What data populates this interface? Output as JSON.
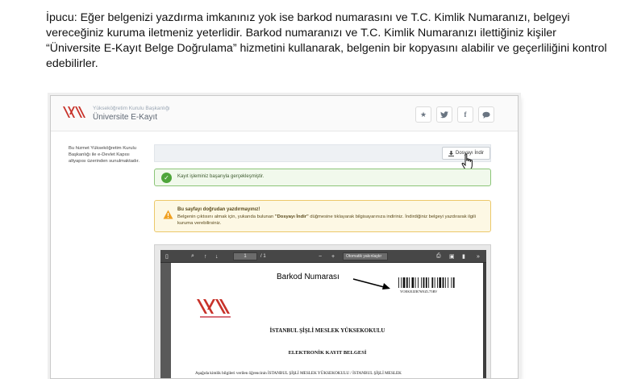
{
  "intro_text": "İpucu: Eğer belgenizi yazdırma imkanınız yok ise barkod numarasını ve T.C. Kimlik Numaranızı, belgeyi vereceğiniz kuruma iletmeniz yeterlidir. Barkod numaranızı ve T.C. Kimlik Numaranızı ilettiğiniz kişiler “Üniversite E-Kayıt Belge Doğrulama” hizmetini kullanarak, belgenin bir kopyasını alabilir ve geçerliliğini kontrol edebilirler.",
  "header": {
    "org_name": "Yükseköğretim Kurulu Başkanlığı",
    "app_name": "Üniversite E-Kayıt",
    "social_icons": [
      "star-icon",
      "twitter-icon",
      "facebook-icon",
      "comment-icon"
    ]
  },
  "sidebar_text": "Bu hizmet Yükseköğretim Kurulu Başkanlığı ile e-Devlet Kapısı altyapısı üzerinden sunulmaktadır.",
  "toolbar": {
    "download_label": "Dosyayı İndir"
  },
  "success_alert": {
    "text": "Kayıt işleminiz başarıyla gerçekleşmiştir."
  },
  "warning_alert": {
    "title": "Bu sayfayı doğrudan yazdırmayınız!",
    "body_before": "Belgenin çıktısını almak için, yukarıda bulunan ",
    "body_bold": "\"Dosyayı İndir\"",
    "body_after": " düğmesine tıklayarak bilgisayarınıza indiriniz. İndirdiğiniz belgeyi yazdırarak ilgili kuruma verebilirsiniz."
  },
  "pdf_viewer": {
    "page_value": "1",
    "page_total": "/ 1",
    "zoom_label": "Otomatik yakınlaştır",
    "barcode_number": "YOEKEJZR76NZL75RV",
    "school_name": "İSTANBUL ŞİŞLİ MESLEK YÜKSEKOKULU",
    "doc_title": "ELEKTRONİK KAYIT BELGESİ",
    "doc_paragraph": "Aşağıda kimlik bilgileri verilen öğrencinin İSTANBUL ŞİŞLİ MESLEK YÜKSEKOKULU / İSTANBUL ŞİŞLİ MESLEK"
  },
  "annotation": {
    "label": "Barkod Numarası"
  },
  "colors": {
    "success": "#4ea53a",
    "warning": "#ecc86a",
    "yok_red": "#c8322a",
    "viewer_toolbar": "#474747"
  }
}
